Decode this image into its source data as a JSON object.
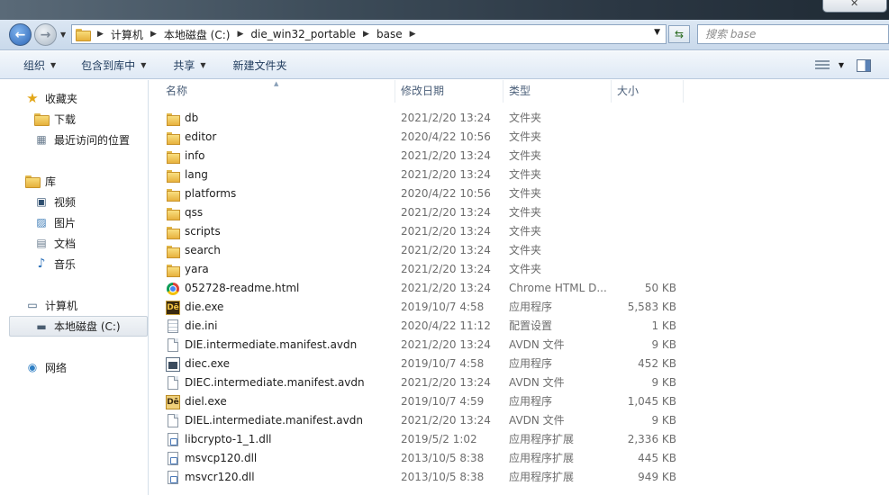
{
  "address": {
    "crumbs": [
      "计算机",
      "本地磁盘 (C:)",
      "die_win32_portable",
      "base"
    ],
    "search_placeholder": "搜索 base"
  },
  "toolbar": {
    "organize": "组织",
    "include_in_library": "包含到库中",
    "share": "共享",
    "new_folder": "新建文件夹"
  },
  "navpane": {
    "favorites": "收藏夹",
    "downloads": "下载",
    "recent": "最近访问的位置",
    "libraries": "库",
    "videos": "视频",
    "pictures": "图片",
    "documents": "文档",
    "music": "音乐",
    "computer": "计算机",
    "local_disk": "本地磁盘 (C:)",
    "network": "网络"
  },
  "columns": {
    "name": "名称",
    "date": "修改日期",
    "type": "类型",
    "size": "大小"
  },
  "files": [
    {
      "name": "db",
      "date": "2021/2/20 13:24",
      "type": "文件夹",
      "size": "",
      "icon": "folder"
    },
    {
      "name": "editor",
      "date": "2020/4/22 10:56",
      "type": "文件夹",
      "size": "",
      "icon": "folder"
    },
    {
      "name": "info",
      "date": "2021/2/20 13:24",
      "type": "文件夹",
      "size": "",
      "icon": "folder"
    },
    {
      "name": "lang",
      "date": "2021/2/20 13:24",
      "type": "文件夹",
      "size": "",
      "icon": "folder"
    },
    {
      "name": "platforms",
      "date": "2020/4/22 10:56",
      "type": "文件夹",
      "size": "",
      "icon": "folder"
    },
    {
      "name": "qss",
      "date": "2021/2/20 13:24",
      "type": "文件夹",
      "size": "",
      "icon": "folder"
    },
    {
      "name": "scripts",
      "date": "2021/2/20 13:24",
      "type": "文件夹",
      "size": "",
      "icon": "folder"
    },
    {
      "name": "search",
      "date": "2021/2/20 13:24",
      "type": "文件夹",
      "size": "",
      "icon": "folder"
    },
    {
      "name": "yara",
      "date": "2021/2/20 13:24",
      "type": "文件夹",
      "size": "",
      "icon": "folder"
    },
    {
      "name": "052728-readme.html",
      "date": "2021/2/20 13:24",
      "type": "Chrome HTML D...",
      "size": "50 KB",
      "icon": "chrome"
    },
    {
      "name": "die.exe",
      "date": "2019/10/7 4:58",
      "type": "应用程序",
      "size": "5,583 KB",
      "icon": "die"
    },
    {
      "name": "die.ini",
      "date": "2020/4/22 11:12",
      "type": "配置设置",
      "size": "1 KB",
      "icon": "ini"
    },
    {
      "name": "DIE.intermediate.manifest.avdn",
      "date": "2021/2/20 13:24",
      "type": "AVDN 文件",
      "size": "9 KB",
      "icon": "doc"
    },
    {
      "name": "diec.exe",
      "date": "2019/10/7 4:58",
      "type": "应用程序",
      "size": "452 KB",
      "icon": "cexe"
    },
    {
      "name": "DIEC.intermediate.manifest.avdn",
      "date": "2021/2/20 13:24",
      "type": "AVDN 文件",
      "size": "9 KB",
      "icon": "doc"
    },
    {
      "name": "diel.exe",
      "date": "2019/10/7 4:59",
      "type": "应用程序",
      "size": "1,045 KB",
      "icon": "diel"
    },
    {
      "name": "DIEL.intermediate.manifest.avdn",
      "date": "2021/2/20 13:24",
      "type": "AVDN 文件",
      "size": "9 KB",
      "icon": "doc"
    },
    {
      "name": "libcrypto-1_1.dll",
      "date": "2019/5/2 1:02",
      "type": "应用程序扩展",
      "size": "2,336 KB",
      "icon": "dll"
    },
    {
      "name": "msvcp120.dll",
      "date": "2013/10/5 8:38",
      "type": "应用程序扩展",
      "size": "445 KB",
      "icon": "dll"
    },
    {
      "name": "msvcr120.dll",
      "date": "2013/10/5 8:38",
      "type": "应用程序扩展",
      "size": "949 KB",
      "icon": "dll"
    }
  ]
}
